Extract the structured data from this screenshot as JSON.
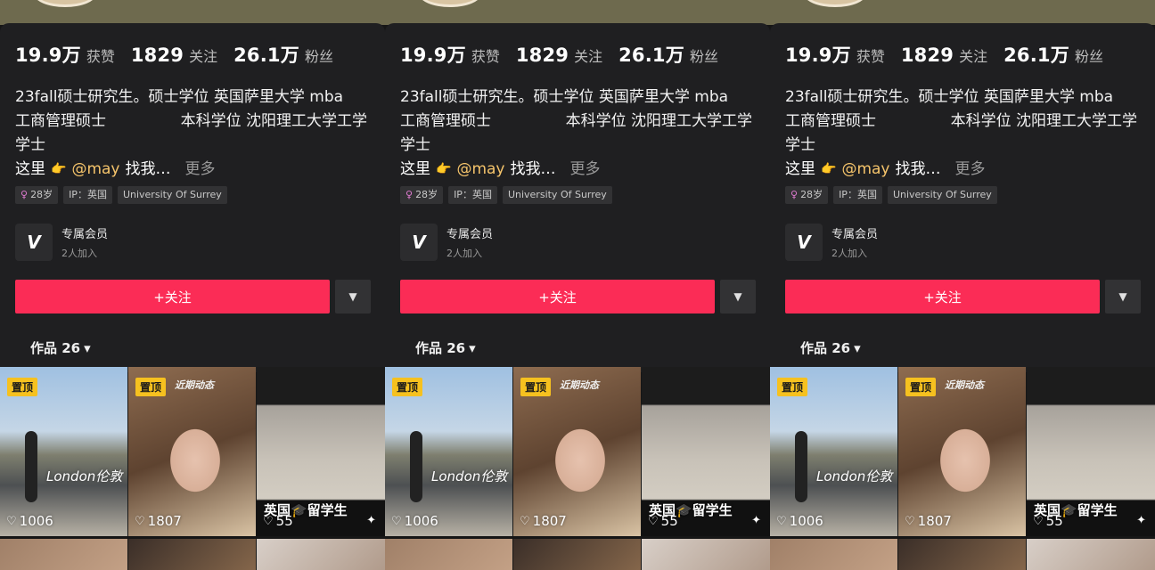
{
  "profile": {
    "stats": [
      {
        "value": "19.9万",
        "label": "获赞"
      },
      {
        "value": "1829",
        "label": "关注"
      },
      {
        "value": "26.1万",
        "label": "粉丝"
      }
    ],
    "bio": {
      "line1": "23fall硕士研究生。硕士学位 英国萨里大学 mba",
      "line2_left": "工商管理硕士",
      "line2_right": "本科学位 沈阳理工大学工学",
      "line3": "学士",
      "prefix": "这里",
      "hand": "👉",
      "mention": "@may",
      "suffix": "找我…",
      "more": "更多"
    },
    "tags": {
      "gender_icon": "♀",
      "age": "28岁",
      "ip": "IP：英国",
      "school": "University Of Surrey"
    },
    "membership": {
      "logo": "V",
      "name": "专属会员",
      "count": "2人加入"
    },
    "follow_label": "+关注",
    "follow_more_icon": "▼",
    "works_label": "作品 26",
    "works_caret": "▾"
  },
  "videos": [
    {
      "pinned": "置顶",
      "overlay": "London伦敦",
      "likes": "1006"
    },
    {
      "pinned": "置顶",
      "overlay": "近期动态",
      "likes": "1807"
    },
    {
      "overlay": "英国🎓留学生",
      "likes": "55",
      "sparkle": "✦"
    }
  ],
  "heart_icon": "♡",
  "colors": {
    "follow_button": "#fb2c56",
    "pin_badge": "#f6c11f",
    "mention": "#f5c46b"
  }
}
